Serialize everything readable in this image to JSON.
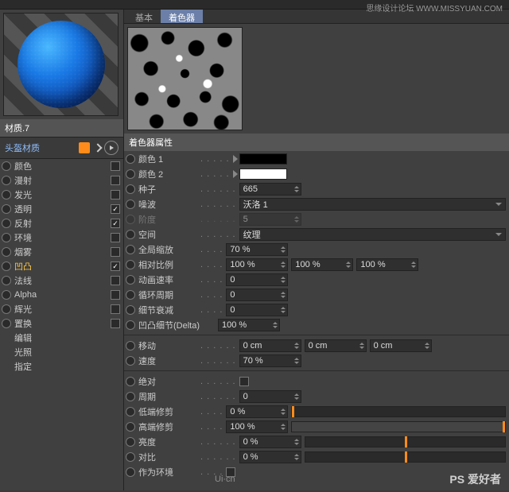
{
  "watermarks": {
    "top": "思缘设计论坛  WWW.MISSYUAN.COM",
    "logo": "Ui·cn",
    "bottom": "PS 爱好者"
  },
  "material": {
    "name": "材质.7",
    "header": "头盔材质"
  },
  "channels": [
    {
      "label": "颜色",
      "cb": false,
      "hl": false
    },
    {
      "label": "漫射",
      "cb": false,
      "hl": false
    },
    {
      "label": "发光",
      "cb": false,
      "hl": false
    },
    {
      "label": "透明",
      "cb": true,
      "hl": false
    },
    {
      "label": "反射",
      "cb": true,
      "hl": false
    },
    {
      "label": "环境",
      "cb": false,
      "hl": false
    },
    {
      "label": "烟雾",
      "cb": false,
      "hl": false
    },
    {
      "label": "凹凸",
      "cb": true,
      "hl": true
    },
    {
      "label": "法线",
      "cb": false,
      "hl": false
    },
    {
      "label": "Alpha",
      "cb": false,
      "hl": false
    },
    {
      "label": "辉光",
      "cb": false,
      "hl": false
    },
    {
      "label": "置换",
      "cb": false,
      "hl": false
    }
  ],
  "simple_rows": [
    "编辑",
    "光照",
    "指定"
  ],
  "tabs": {
    "basic": "基本",
    "shader": "着色器"
  },
  "section": "着色器属性",
  "p": {
    "color1": "颜色 1",
    "color1_val": "#000000",
    "color2": "颜色 2",
    "color2_val": "#ffffff",
    "seed": "种子",
    "seed_val": "665",
    "noise": "噪波",
    "noise_val": "沃洛 1",
    "octaves": "阶度",
    "octaves_val": "5",
    "space": "空间",
    "space_val": "纹理",
    "global": "全局缩放",
    "global_val": "70 %",
    "relative": "相对比例",
    "rel1": "100 %",
    "rel2": "100 %",
    "rel3": "100 %",
    "anim": "动画速率",
    "anim_val": "0",
    "cycle": "循环周期",
    "cycle_val": "0",
    "detail": "细节衰减",
    "detail_val": "0",
    "delta": "凹凸细节(Delta)",
    "delta_val": "100 %",
    "move": "移动",
    "m1": "0 cm",
    "m2": "0 cm",
    "m3": "0 cm",
    "speed": "速度",
    "speed_val": "70 %",
    "abs": "绝对",
    "period": "周期",
    "period_val": "0",
    "lowclip": "低端修剪",
    "lowclip_val": "0 %",
    "lowclip_pct": 0,
    "highclip": "高端修剪",
    "highclip_val": "100 %",
    "highclip_pct": 100,
    "bright": "亮度",
    "bright_val": "0 %",
    "bright_pct": 50,
    "contrast": "对比",
    "contrast_val": "0 %",
    "contrast_pct": 50,
    "asenv": "作为环境"
  }
}
